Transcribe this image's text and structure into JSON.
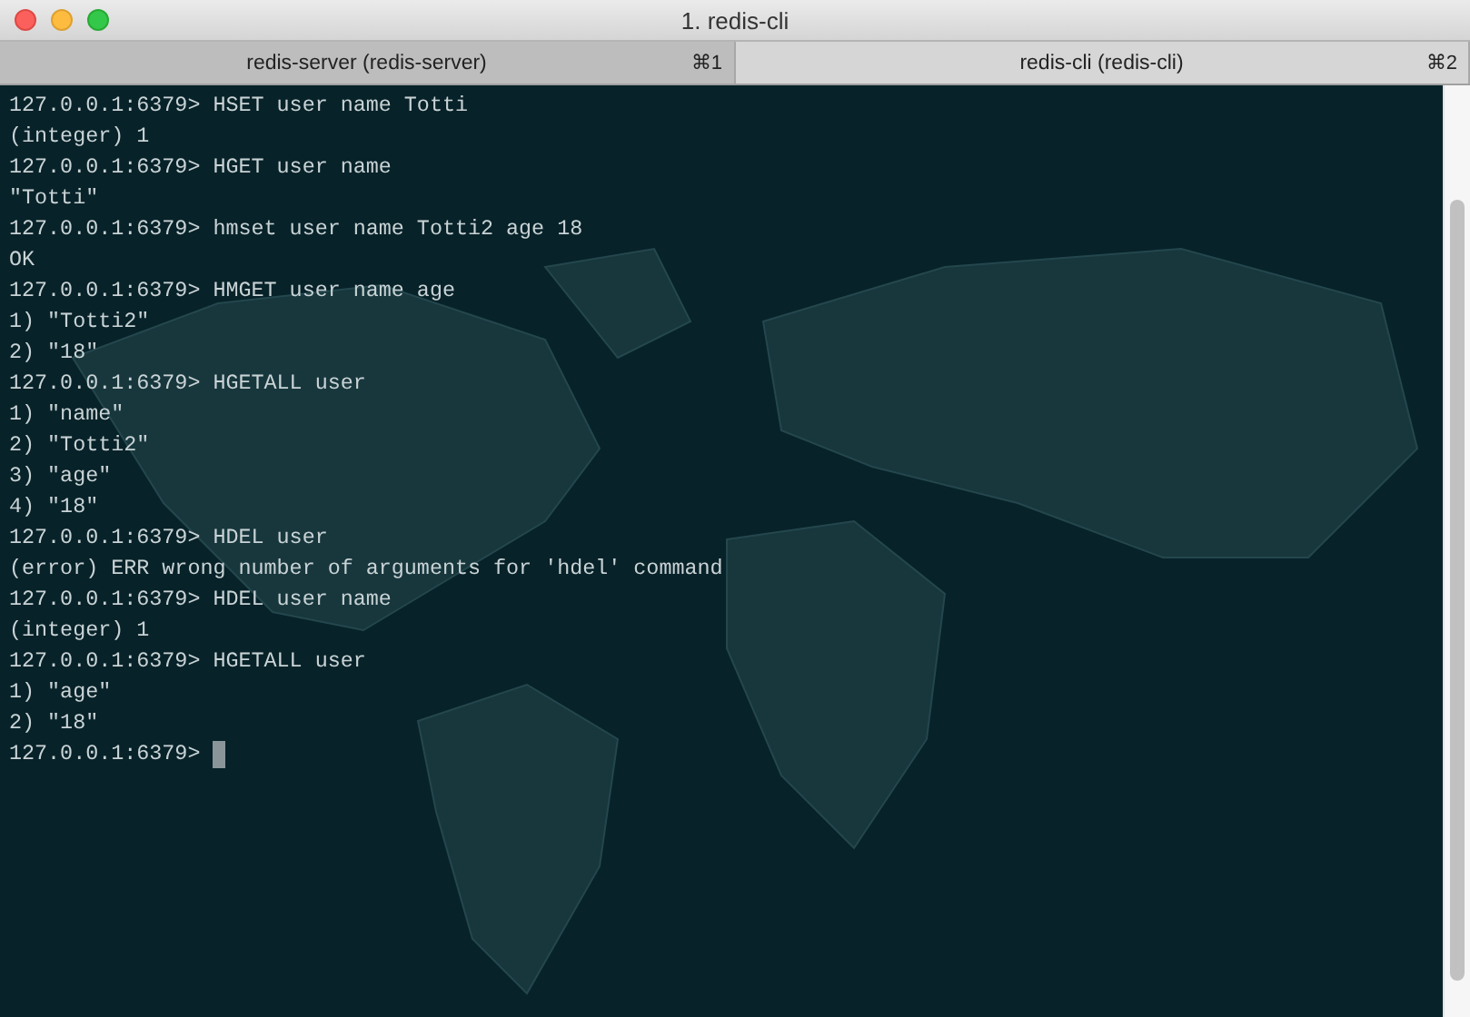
{
  "window": {
    "title": "1. redis-cli"
  },
  "tabs": [
    {
      "label": "redis-server (redis-server)",
      "shortcut": "⌘1",
      "selected": false
    },
    {
      "label": "redis-cli (redis-cli)",
      "shortcut": "⌘2",
      "selected": true
    }
  ],
  "terminal": {
    "lines": [
      "127.0.0.1:6379> HSET user name Totti",
      "(integer) 1",
      "127.0.0.1:6379> HGET user name",
      "\"Totti\"",
      "127.0.0.1:6379> hmset user name Totti2 age 18",
      "OK",
      "127.0.0.1:6379> HMGET user name age",
      "1) \"Totti2\"",
      "2) \"18\"",
      "127.0.0.1:6379> HGETALL user",
      "1) \"name\"",
      "2) \"Totti2\"",
      "3) \"age\"",
      "4) \"18\"",
      "127.0.0.1:6379> HDEL user",
      "(error) ERR wrong number of arguments for 'hdel' command",
      "127.0.0.1:6379> HDEL user name",
      "(integer) 1",
      "127.0.0.1:6379> HGETALL user",
      "1) \"age\"",
      "2) \"18\""
    ],
    "prompt": "127.0.0.1:6379>"
  }
}
